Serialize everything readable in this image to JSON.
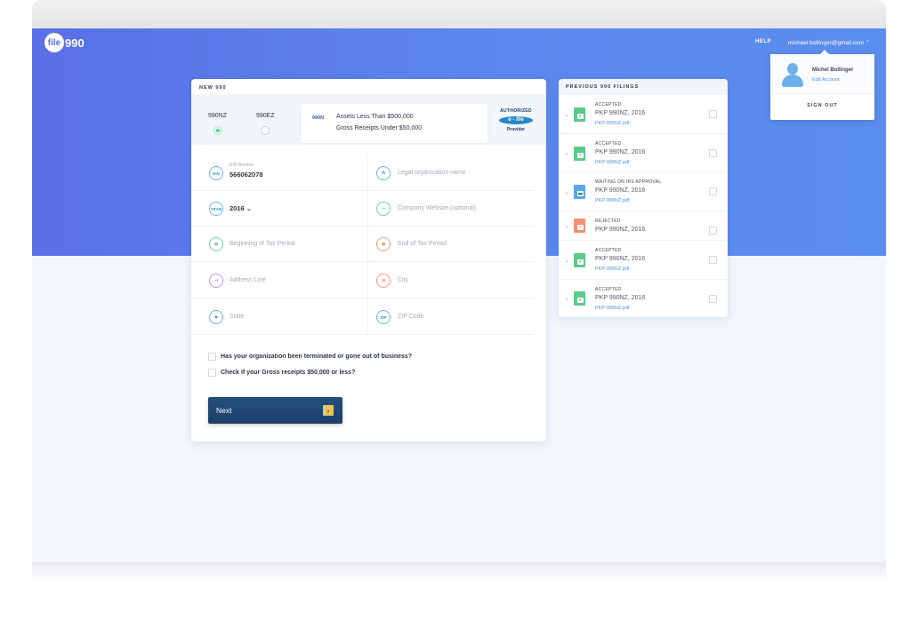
{
  "topbar": {
    "logo_mark": "file",
    "logo_text": "990",
    "help": "HELP",
    "email": "michael.bollinger@gmail.com ⌃"
  },
  "profile": {
    "name": "Michel Bollinger",
    "edit": "Edit Account",
    "signout": "SIGN OUT"
  },
  "new990": {
    "title": "NEW 990",
    "options": [
      {
        "label": "990NZ",
        "selected": true
      },
      {
        "label": "990EZ",
        "selected": false
      }
    ],
    "info_tag": "990N",
    "info_line1": "Assets Less Than $500,000",
    "info_line2": "Gross Receipts Under $50,000",
    "authorized": "AUTHORIZED",
    "efile": "e - file",
    "provider": "Provider",
    "fields": {
      "ein_small": "EIN Number",
      "ein_value": "566062078",
      "ein_icon": "EIN",
      "legal_name": "Legal organization name",
      "year_icon": "YEAR",
      "year_value": "2016 ⌄",
      "website": "Company Website (optional)",
      "begin": "Beginning of Tax Period",
      "end": "End of Tax Period",
      "address": "Address Line",
      "city": "City",
      "state": "State",
      "zip_icon": "ZIP",
      "zip": "ZIP Code"
    },
    "question1": "Has your organization been terminated or gone out of business?",
    "question2": "Check if your Gross receipts $50,000 or less?",
    "next": "Next",
    "next_arrow": "›"
  },
  "previous": {
    "title": "PREVIOUS 990 FILINGS",
    "items": [
      {
        "status": "ACCEPTED",
        "name": "PKP 990NZ, 2016",
        "file": "PKP-990NZ.pdf",
        "color": "#5cc98a"
      },
      {
        "status": "ACCEPTED",
        "name": "PKP 990NZ, 2016",
        "file": "PKP-990NZ.pdf",
        "color": "#5cc98a"
      },
      {
        "status": "WAITING ON IRS APPROVAL",
        "name": "PKP 990NZ, 2016",
        "file": "PKP-990NZ.pdf",
        "color": "#5aa6ea"
      },
      {
        "status": "REJECTED",
        "name": "PKP 990NZ, 2016",
        "file": "",
        "color": "#f29072"
      },
      {
        "status": "ACCEPTED",
        "name": "PKP 990NZ, 2016",
        "file": "PKP-990NZ.pdf",
        "color": "#5cc98a"
      },
      {
        "status": "ACCEPTED",
        "name": "PKP 990NZ, 2016",
        "file": "PKP-990NZ.pdf",
        "color": "#5cc98a"
      }
    ]
  }
}
